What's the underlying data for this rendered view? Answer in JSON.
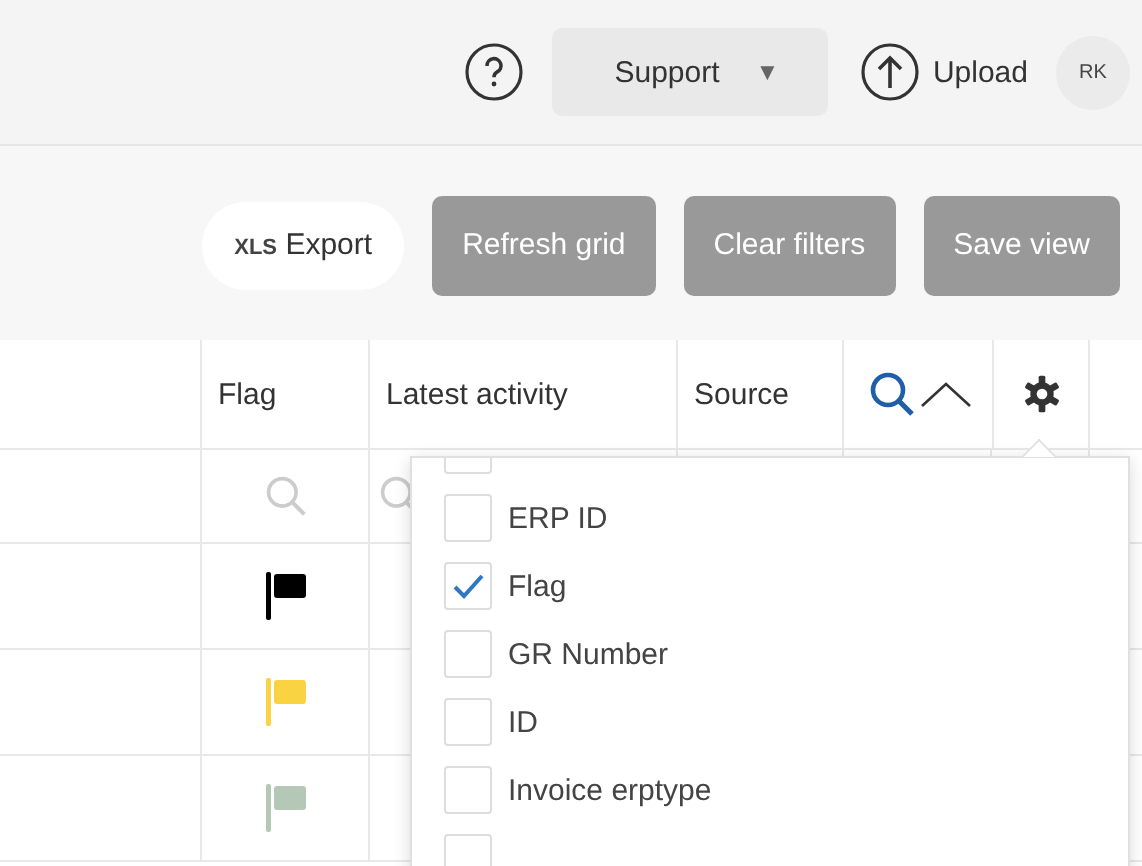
{
  "header": {
    "support": {
      "label": "Support",
      "caret": "▼"
    },
    "upload": {
      "label": "Upload"
    },
    "avatar": {
      "initials": "RK"
    }
  },
  "toolbar": {
    "export": {
      "prefix": "XLS",
      "label": "Export"
    },
    "buttons": [
      "Refresh grid",
      "Clear filters",
      "Save view"
    ]
  },
  "table": {
    "columns": [
      "Flag",
      "Latest activity",
      "Source"
    ],
    "rows": [
      {
        "color": "#000000"
      },
      {
        "color": "#f9d342"
      },
      {
        "color": "#b5c8b8"
      }
    ]
  },
  "columns_menu": {
    "items": [
      {
        "checked": false
      },
      {
        "label": "ERP ID",
        "checked": false
      },
      {
        "label": "Flag",
        "checked": true
      },
      {
        "label": "GR Number",
        "checked": false
      },
      {
        "label": "ID",
        "checked": false
      },
      {
        "label": "Invoice erptype",
        "checked": false
      },
      {
        "checked": false
      }
    ]
  }
}
